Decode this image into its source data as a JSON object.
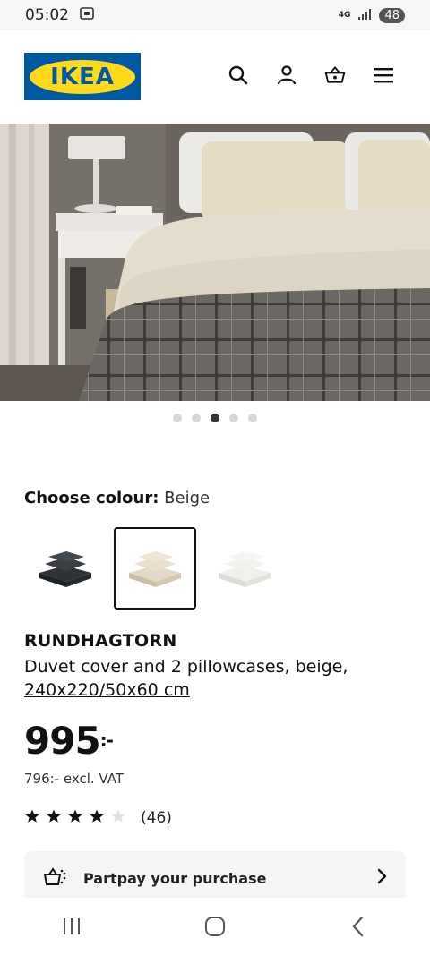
{
  "status_bar": {
    "time": "05:02",
    "network": "4G",
    "battery": "48"
  },
  "header": {
    "logo_text": "IKEA",
    "icons": [
      "search-icon",
      "user-icon",
      "basket-icon",
      "menu-icon"
    ]
  },
  "gallery": {
    "dot_count": 5,
    "active_index": 2
  },
  "colour": {
    "label": "Choose colour:",
    "selected": "Beige",
    "options": [
      "dark-grey",
      "beige",
      "white"
    ]
  },
  "product": {
    "name": "RUNDHAGTORN",
    "description": "Duvet cover and 2 pillowcases, beige,",
    "size": "240x220/50x60 cm",
    "price": "995",
    "price_suffix": ":-",
    "excl_vat": "796:- excl. VAT",
    "rating": 4,
    "rating_max": 5,
    "review_count": "(46)"
  },
  "partpay": {
    "label": "Partpay your purchase"
  },
  "colors": {
    "brand_blue": "#0058a3",
    "brand_yellow": "#ffda1a"
  }
}
